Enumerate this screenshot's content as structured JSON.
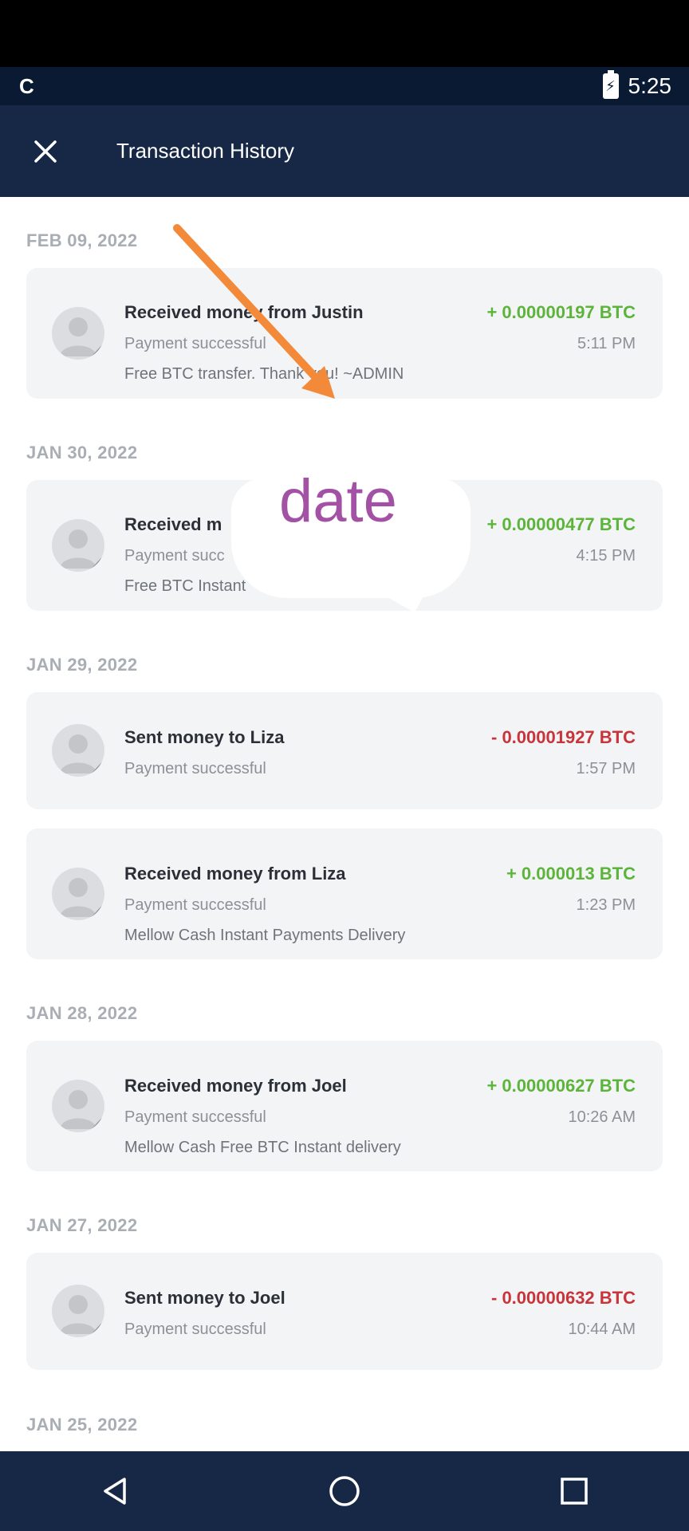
{
  "status_bar": {
    "left_text": "C",
    "time": "5:25"
  },
  "header": {
    "title": "Transaction History"
  },
  "groups": [
    {
      "date": "FEB 09, 2022",
      "transactions": [
        {
          "title": "Received money from Justin",
          "amount": "+ 0.00000197 BTC",
          "direction": "in",
          "status": "Payment successful",
          "time": "5:11 PM",
          "note": "Free BTC transfer. Thank you! ~ADMIN"
        }
      ]
    },
    {
      "date": "JAN 30, 2022",
      "transactions": [
        {
          "title": "Received m",
          "amount": "+ 0.00000477 BTC",
          "direction": "in",
          "status": "Payment succ",
          "time": "4:15 PM",
          "note": "Free BTC Instant"
        }
      ]
    },
    {
      "date": "JAN 29, 2022",
      "transactions": [
        {
          "title": "Sent money to Liza",
          "amount": "- 0.00001927 BTC",
          "direction": "out",
          "status": "Payment successful",
          "time": "1:57 PM",
          "note": ""
        },
        {
          "title": "Received money from Liza",
          "amount": "+ 0.000013 BTC",
          "direction": "in",
          "status": "Payment successful",
          "time": "1:23 PM",
          "note": "Mellow Cash Instant Payments Delivery"
        }
      ]
    },
    {
      "date": "JAN 28, 2022",
      "transactions": [
        {
          "title": "Received money from Joel",
          "amount": "+ 0.00000627 BTC",
          "direction": "in",
          "status": "Payment successful",
          "time": "10:26 AM",
          "note": "Mellow Cash Free BTC Instant delivery"
        }
      ]
    },
    {
      "date": "JAN 27, 2022",
      "transactions": [
        {
          "title": "Sent money to Joel",
          "amount": "- 0.00000632 BTC",
          "direction": "out",
          "status": "Payment successful",
          "time": "10:44 AM",
          "note": ""
        }
      ]
    },
    {
      "date": "JAN 25, 2022",
      "transactions": []
    }
  ],
  "annotation": {
    "label": "date",
    "arrow_color": "#f28a3a",
    "label_color": "#a251a4"
  },
  "colors": {
    "app_bar": "#172846",
    "positive": "#5cb53a",
    "negative": "#c8343a"
  },
  "icons": {
    "close": "close-icon",
    "avatar": "person-avatar-icon",
    "nav_back": "back-triangle-icon",
    "nav_home": "home-circle-icon",
    "nav_recents": "recents-square-icon"
  }
}
